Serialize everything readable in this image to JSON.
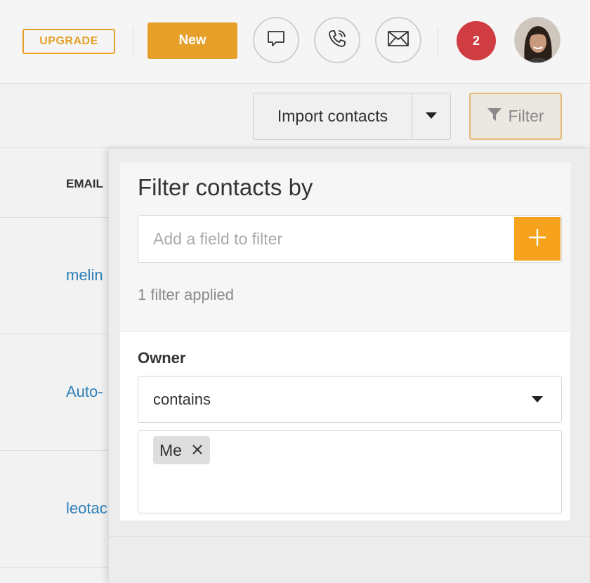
{
  "header": {
    "upgrade_label": "UPGRADE",
    "new_label": "New",
    "notification_count": "2",
    "icons": [
      "chat-icon",
      "phone-icon",
      "mail-icon"
    ]
  },
  "toolbar": {
    "import_label": "Import contacts",
    "filter_label": "Filter"
  },
  "table": {
    "email_header": "EMAIL",
    "rows": [
      "melin",
      "Auto-",
      "leotac"
    ]
  },
  "filter_panel": {
    "title": "Filter contacts by",
    "field_placeholder": "Add a field to filter",
    "applied_count": "1 filter applied",
    "owner_label": "Owner",
    "operator": "contains",
    "values": [
      "Me"
    ]
  },
  "colors": {
    "accent": "#e6a02a",
    "add_button": "#f6a21c",
    "badge": "#cf3d43",
    "link": "#2d7fb8"
  }
}
